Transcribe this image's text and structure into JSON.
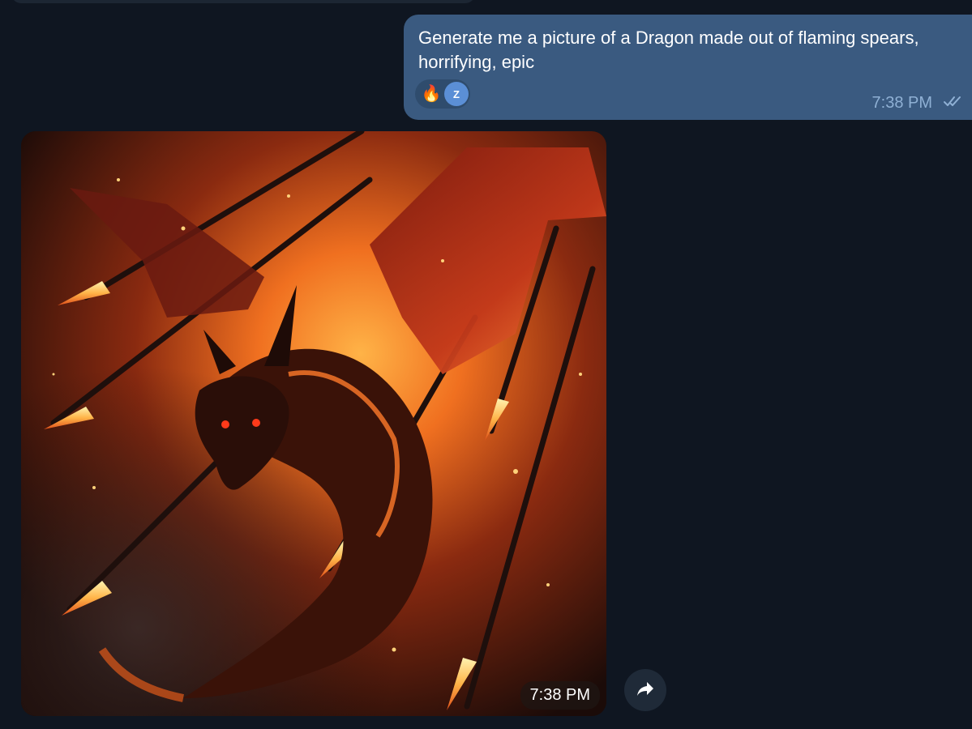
{
  "outgoing_message": {
    "text": "Generate me a picture of a Dragon made out of flaming spears, horrifying, epic",
    "time": "7:38 PM",
    "status_icon": "double-check-icon",
    "reactions": [
      {
        "emoji": "🔥",
        "name": "fire-reaction"
      },
      {
        "avatar_letter": "Z",
        "name": "reactor-avatar"
      }
    ]
  },
  "image_message": {
    "time": "7:38 PM",
    "forward_icon": "forward-arrow-icon"
  },
  "colors": {
    "background": "#0f1621",
    "outgoing_bubble": "#3a5a80",
    "meta_text": "#8fb0d4",
    "avatar": "#5b8fd6"
  }
}
